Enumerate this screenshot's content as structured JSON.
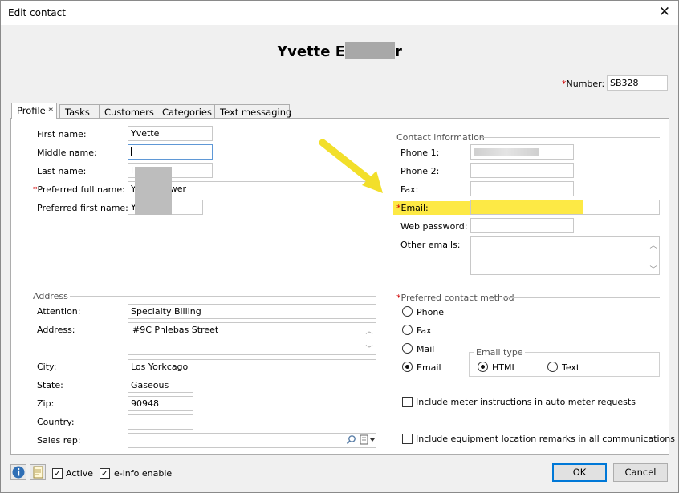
{
  "window": {
    "title": "Edit contact",
    "close_glyph": "✕"
  },
  "header": {
    "name_visible": "Yvette E",
    "name_tail": "r"
  },
  "number": {
    "label": "Number:",
    "value": "SB328"
  },
  "tabs": [
    {
      "label": "Profile *",
      "active": true
    },
    {
      "label": "Tasks"
    },
    {
      "label": "Customers"
    },
    {
      "label": "Categories"
    },
    {
      "label": "Text messaging"
    }
  ],
  "profile": {
    "first_name_label": "First name:",
    "first_name": "Yvette",
    "middle_name_label": "Middle name:",
    "middle_name": "",
    "last_name_label": "Last name:",
    "last_name": "l",
    "preferred_full_name_label": "Preferred full name:",
    "preferred_full_name_start": "Y",
    "preferred_full_name_end": "wer",
    "preferred_first_name_label": "Preferred first name:",
    "preferred_first_name": "Y"
  },
  "contact": {
    "section_title": "Contact information",
    "phone1_label": "Phone 1:",
    "phone2_label": "Phone 2:",
    "fax_label": "Fax:",
    "email_label": "Email:",
    "web_password_label": "Web password:",
    "other_emails_label": "Other emails:"
  },
  "address": {
    "section_title": "Address",
    "attention_label": "Attention:",
    "attention": "Specialty Billing",
    "address_label": "Address:",
    "address": "#9C Phlebas Street",
    "city_label": "City:",
    "city": "Los Yorkcago",
    "state_label": "State:",
    "state": "Gaseous",
    "zip_label": "Zip:",
    "zip": "90948",
    "country_label": "Country:",
    "country": "",
    "sales_rep_label": "Sales rep:",
    "sales_rep": ""
  },
  "preferred_contact": {
    "section_title": "Preferred contact method",
    "options": [
      "Phone",
      "Fax",
      "Mail",
      "Email"
    ],
    "selected": "Email",
    "email_type_title": "Email type",
    "email_types": [
      "HTML",
      "Text"
    ],
    "email_type_selected": "HTML"
  },
  "checkboxes": {
    "meter_instructions": "Include meter instructions in auto meter requests",
    "equipment_remarks": "Include equipment location remarks in all communications"
  },
  "footer": {
    "active_label": "Active",
    "active_checked": true,
    "einfo_label": "e-info enable",
    "einfo_checked": true,
    "ok_label": "OK",
    "cancel_label": "Cancel"
  },
  "colors": {
    "accent": "#0078d7",
    "required": "#d00000",
    "highlight": "#fde945",
    "arrow": "#f2df2a"
  },
  "icons": {
    "info": "info-icon",
    "notes": "notes-icon",
    "search": "search-icon",
    "card": "contact-card-icon"
  }
}
